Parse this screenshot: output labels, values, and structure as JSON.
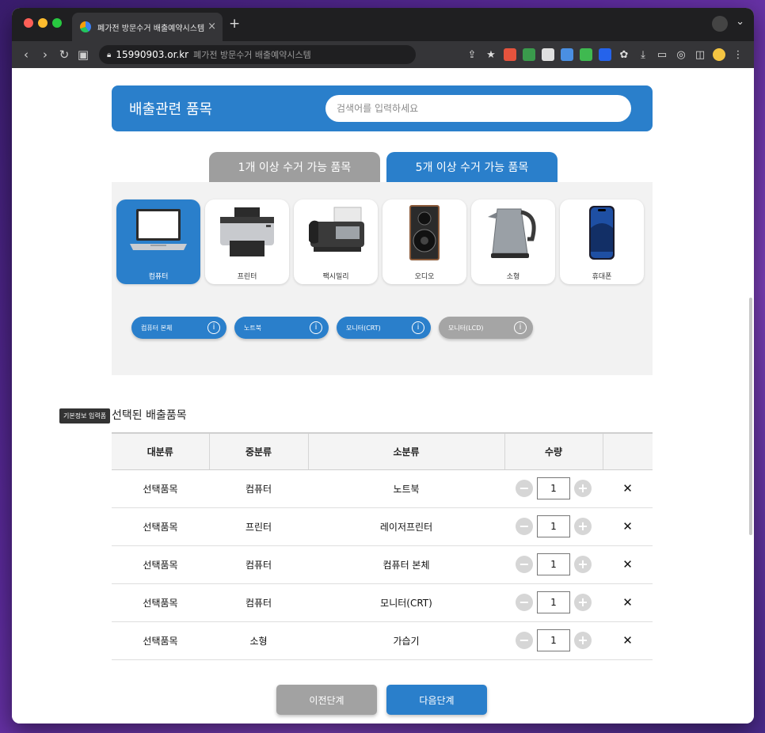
{
  "browser": {
    "tab_title": "폐가전 방문수거 배출예약시스템",
    "tab_close": "×",
    "new_tab": "+",
    "url_domain": "15990903.or.kr",
    "url_title": "폐가전 방문수거 배출예약시스템"
  },
  "search": {
    "title": "배출관련 품목",
    "placeholder": "검색어를 입력하세요"
  },
  "category_tabs": [
    {
      "label": "1개 이상 수거 가능 품목",
      "active": false
    },
    {
      "label": "5개 이상 수거 가능 품목",
      "active": true
    }
  ],
  "items": [
    {
      "label": "컴퓨터",
      "icon": "laptop-icon",
      "selected": true
    },
    {
      "label": "프린터",
      "icon": "printer-icon",
      "selected": false
    },
    {
      "label": "팩시밀리",
      "icon": "fax-icon",
      "selected": false
    },
    {
      "label": "오디오",
      "icon": "speaker-icon",
      "selected": false
    },
    {
      "label": "소형",
      "icon": "kettle-icon",
      "selected": false
    },
    {
      "label": "휴대폰",
      "icon": "phone-icon",
      "selected": false
    }
  ],
  "sub_items": [
    {
      "label": "컴퓨터 본체",
      "state": "blue"
    },
    {
      "label": "노트북",
      "state": "blue"
    },
    {
      "label": "모니터(CRT)",
      "state": "blue"
    },
    {
      "label": "모니터(LCD)",
      "state": "gray"
    }
  ],
  "info_glyph": "i",
  "selected_section_title": "선택된 배출품목",
  "tooltip": "기본정보 입력폼",
  "table": {
    "headers": [
      "대분류",
      "중분류",
      "소분류",
      "수량",
      ""
    ],
    "rows": [
      {
        "c1": "선택품목",
        "c2": "컴퓨터",
        "c3": "노트북",
        "qty": "1"
      },
      {
        "c1": "선택품목",
        "c2": "프린터",
        "c3": "레이저프린터",
        "qty": "1"
      },
      {
        "c1": "선택품목",
        "c2": "컴퓨터",
        "c3": "컴퓨터 본체",
        "qty": "1"
      },
      {
        "c1": "선택품목",
        "c2": "컴퓨터",
        "c3": "모니터(CRT)",
        "qty": "1"
      },
      {
        "c1": "선택품목",
        "c2": "소형",
        "c3": "가습기",
        "qty": "1"
      }
    ],
    "minus": "−",
    "plus": "+",
    "remove": "✕"
  },
  "buttons": {
    "prev": "이전단계",
    "next": "다음단계"
  },
  "colors": {
    "primary": "#2a7fcb",
    "inactive": "#9e9e9e"
  }
}
